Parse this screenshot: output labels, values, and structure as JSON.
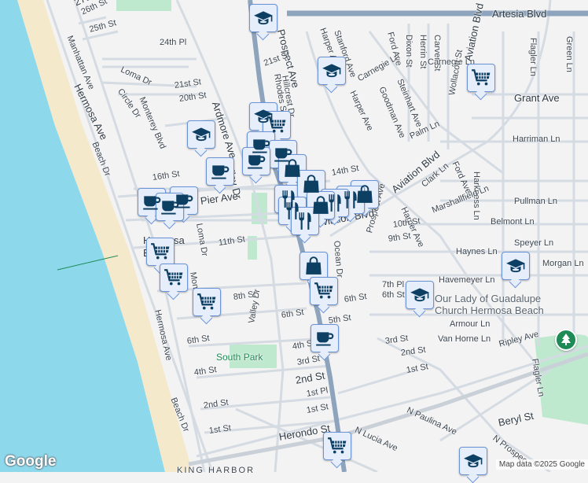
{
  "map": {
    "colors": {
      "water": "#8ed8ec",
      "beach": "#f5e9cc",
      "land": "#f4f3f4",
      "road": "#d5dbe2",
      "highway": "#8ea4bd",
      "park": "#bfe9cf",
      "marker_fill": "#e6eefc",
      "marker_border": "#6b94d6",
      "icon": "#0d3f63"
    },
    "streets": {
      "artesia": "Artesia Blvd",
      "s27": "27th",
      "s26": "26th St",
      "s25": "25th St",
      "p24": "24th Pl",
      "manhattan": "Manhattan Ave",
      "hermosa_top": "Hermosa Ave",
      "loma": "Loma Dr",
      "circle": "Circle Dr",
      "monterey": "Monterey Blvd",
      "s21": "21st St",
      "s20": "20th St",
      "ardmore": "Ardmore Ave",
      "valley_top": "Valley Dr",
      "beach_top": "Beach Dr",
      "s16": "16th St",
      "pier": "Pier Ave",
      "loma2": "Loma Dr",
      "s11": "11th St",
      "hermosa_city": "Hermosa Beach",
      "hermosa_bot": "Hermosa Ave",
      "monterey2": "Monterey",
      "manhattan2": "Manhattan Ave",
      "s8": "8th St",
      "s6": "6th St",
      "valley": "Valley Dr",
      "south_park": "South Park",
      "s4": "4th St",
      "beach_bot": "Beach Dr",
      "s2": "2nd St",
      "s1": "1st St",
      "king_harbor": "KING HARBOR",
      "herondo": "Herondo St",
      "prospect": "Prospect Ave",
      "hillcrest": "Hillcrest Dr",
      "rhodes": "Rhodes St",
      "s21b": "21st St",
      "harper1": "Harper Ave",
      "stanford": "Stanford Ave",
      "carnegie1": "Carnegie Ln",
      "harper2": "Harper Ave",
      "goodman": "Goodman Ave",
      "steinhart": "Steinhart Ave",
      "ford1": "Ford Ave",
      "dixon": "Dixon St",
      "herrin": "Herrin St",
      "carver": "Carver St",
      "carnegie2": "Carnegie Ln",
      "wollacott": "Wollacott St",
      "aviation_top": "Aviation Blvd",
      "flagler_top": "Flagler Ln",
      "green": "Green Ln",
      "grant": "Grant Ave",
      "palm": "Palm Ln",
      "harriman": "Harriman Ln",
      "aviation": "Aviation Blvd",
      "clark": "Clark Ln",
      "ford2": "Ford Ave",
      "harkness": "Harkness Ln",
      "marshallfield": "Marshallfield Ln",
      "pullman": "Pullman Ln",
      "harper3": "Harper Ave",
      "prospect2": "Prospect Ave",
      "s14": "14th St",
      "aviation_low": "Aviation Blvd",
      "s10": "10th St",
      "belmont": "Belmont Ln",
      "s9": "9th St",
      "speyer": "Speyer Ln",
      "ocean": "Ocean Dr",
      "haynes": "Haynes Ln",
      "morgan": "Morgan Ln",
      "havemeyer": "Havemeyer Ln",
      "p7": "7th Pl",
      "s6b": "6th St",
      "s6c": "6th St",
      "s5": "5th St",
      "s6d": "6th St",
      "armour": "Armour Ln",
      "s3": "3rd St",
      "van_horne": "Van Horne Ln",
      "ripley": "Ripley Ave",
      "s2b": "2nd St",
      "s4b": "4th St",
      "s3b": "3rd St",
      "s2c": "2nd St",
      "p1": "1st Pl",
      "s1b": "1st St",
      "s1c": "1st St",
      "flagler": "Flagler Ln",
      "paulina": "N Paulina Ave",
      "lucia": "N Lucia Ave",
      "beryl": "Beryl St",
      "nprospect": "N Prospec"
    },
    "poi": {
      "guadalupe": "Our Lady of Guadalupe Church Hermosa Beach"
    },
    "markers": [
      {
        "type": "school",
        "icon": "graduation-cap-icon"
      },
      {
        "type": "school",
        "icon": "graduation-cap-icon"
      },
      {
        "type": "grocery",
        "icon": "shopping-cart-icon"
      },
      {
        "type": "school",
        "icon": "graduation-cap-icon"
      },
      {
        "type": "grocery",
        "icon": "shopping-cart-icon"
      },
      {
        "type": "school",
        "icon": "graduation-cap-icon"
      },
      {
        "type": "cafe",
        "icon": "coffee-cup-icon"
      },
      {
        "type": "cafe",
        "icon": "coffee-cup-icon"
      },
      {
        "type": "cafe",
        "icon": "coffee-cup-icon"
      },
      {
        "type": "shopping",
        "icon": "shopping-bag-icon"
      },
      {
        "type": "cafe",
        "icon": "coffee-cup-icon"
      },
      {
        "type": "cafe",
        "icon": "coffee-cup-icon"
      },
      {
        "type": "cafe",
        "icon": "coffee-cup-icon"
      },
      {
        "type": "cafe",
        "icon": "coffee-cup-icon"
      },
      {
        "type": "grocery",
        "icon": "shopping-cart-icon"
      },
      {
        "type": "grocery",
        "icon": "shopping-cart-icon"
      },
      {
        "type": "grocery",
        "icon": "shopping-cart-icon"
      },
      {
        "type": "restaurant",
        "icon": "fork-knife-icon"
      },
      {
        "type": "shopping",
        "icon": "shopping-bag-icon"
      },
      {
        "type": "restaurant",
        "icon": "fork-knife-icon"
      },
      {
        "type": "shopping",
        "icon": "shopping-bag-icon"
      },
      {
        "type": "restaurant",
        "icon": "fork-knife-icon"
      },
      {
        "type": "restaurant",
        "icon": "fork-knife-icon"
      },
      {
        "type": "shopping",
        "icon": "shopping-bag-icon"
      },
      {
        "type": "shopping",
        "icon": "shopping-bag-icon"
      },
      {
        "type": "grocery",
        "icon": "shopping-cart-icon"
      },
      {
        "type": "cafe",
        "icon": "coffee-cup-icon"
      },
      {
        "type": "school",
        "icon": "graduation-cap-icon"
      },
      {
        "type": "school",
        "icon": "graduation-cap-icon"
      },
      {
        "type": "grocery",
        "icon": "shopping-cart-icon"
      },
      {
        "type": "school",
        "icon": "graduation-cap-icon"
      }
    ],
    "logo": "Google",
    "attribution": "Map data ©2025 Google"
  }
}
